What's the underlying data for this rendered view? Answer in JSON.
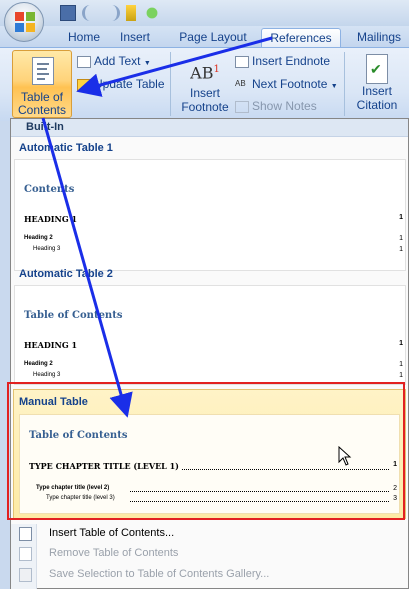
{
  "tabs": [
    {
      "label": "Home"
    },
    {
      "label": "Insert"
    },
    {
      "label": "Page Layout"
    },
    {
      "label": "References"
    },
    {
      "label": "Mailings"
    }
  ],
  "ribbon": {
    "toc_line1": "Table of",
    "toc_line2": "Contents",
    "add_text": "Add Text",
    "update_table": "Update Table",
    "insert_footnote_line1": "Insert",
    "insert_footnote_line2": "Footnote",
    "footnote_glyph": "AB",
    "footnote_sup": "1",
    "insert_endnote": "Insert Endnote",
    "next_footnote": "Next Footnote",
    "show_notes": "Show Notes",
    "insert_citation_line1": "Insert",
    "insert_citation_line2": "Citation"
  },
  "gallery": {
    "header": "Built-In",
    "auto1": {
      "title": "Automatic Table 1",
      "preview_title": "Contents",
      "h1": "HEADING 1",
      "h1_num": "1",
      "h2": "Heading 2",
      "h2_num": "1",
      "h3": "Heading 3",
      "h3_num": "1"
    },
    "auto2": {
      "title": "Automatic Table 2",
      "preview_title": "Table of Contents",
      "h1": "HEADING 1",
      "h1_num": "1",
      "h2": "Heading 2",
      "h2_num": "1",
      "h3": "Heading 3",
      "h3_num": "1"
    },
    "manual": {
      "title": "Manual Table",
      "preview_title": "Table of Contents",
      "l1": "TYPE CHAPTER TITLE (LEVEL 1)",
      "l1_num": "1",
      "l2": "Type chapter title (level 2)",
      "l2_num": "2",
      "l3": "Type chapter title (level 3)",
      "l3_num": "3"
    }
  },
  "menu": {
    "insert_toc": "Insert Table of Contents...",
    "remove_toc": "Remove Table of Contents",
    "save_selection": "Save Selection to Table of Contents Gallery..."
  },
  "colors": {
    "accent_orange": "#ffc252",
    "highlight_red": "#e22121",
    "arrow_blue": "#1a2ee8",
    "ribbon_text": "#15428b"
  }
}
